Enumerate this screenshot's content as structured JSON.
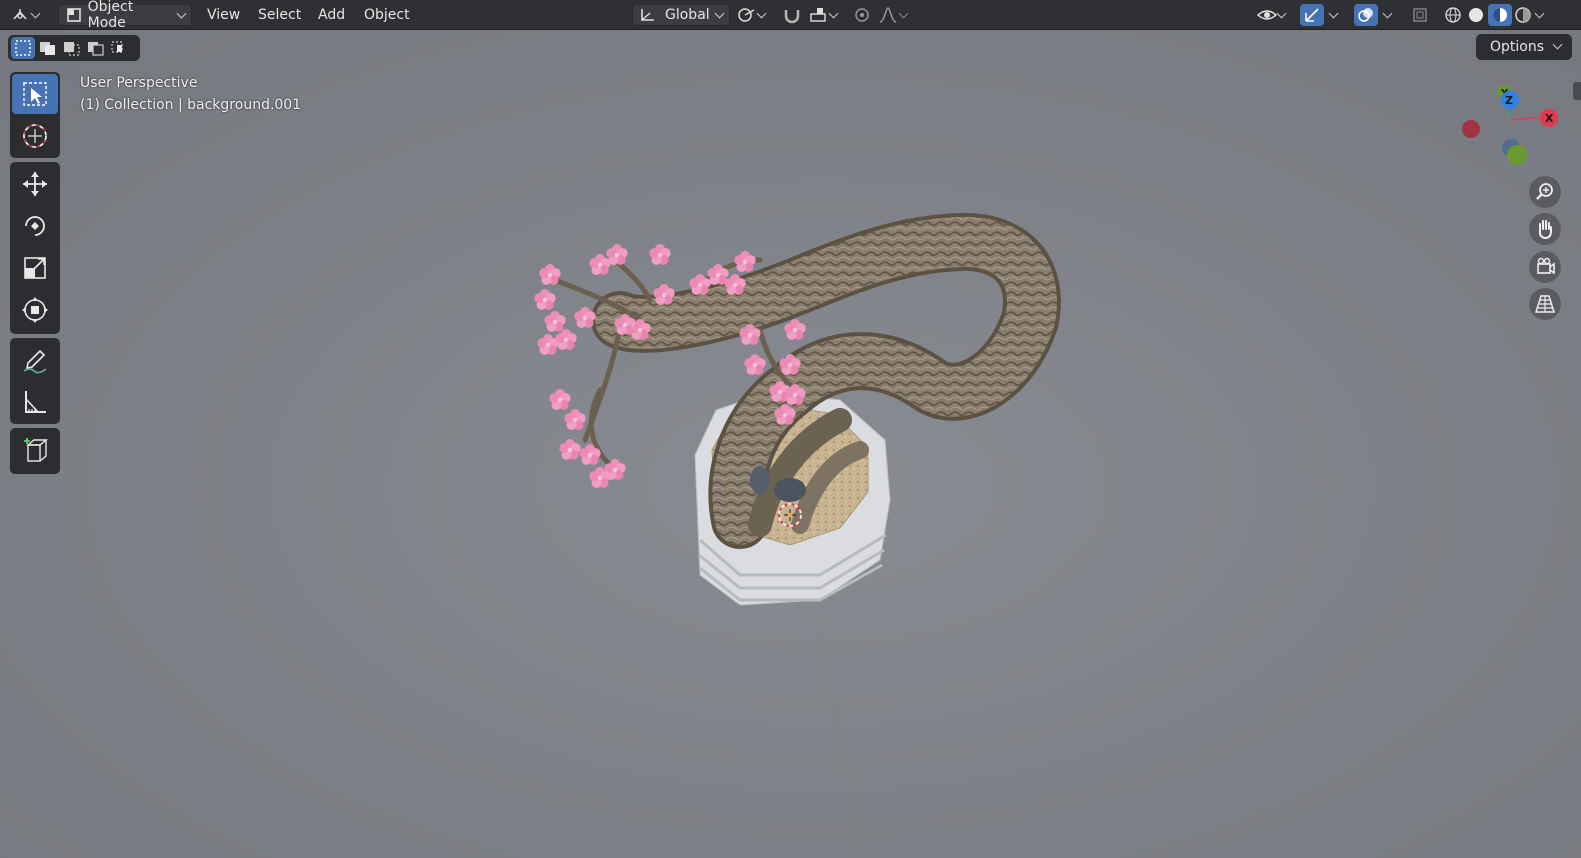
{
  "header": {
    "mode_label": "Object Mode",
    "menus": [
      "View",
      "Select",
      "Add",
      "Object"
    ],
    "orientation_label": "Global"
  },
  "viewport": {
    "perspective_label": "User Perspective",
    "collection_label": "(1) Collection | background.001",
    "options_label": "Options"
  },
  "gizmo": {
    "z_label": "Z",
    "x_label": "X",
    "y_label": "Y",
    "colors": {
      "x": "#e03a4e",
      "y": "#6a9a2e",
      "z": "#2f82e3"
    }
  },
  "colors": {
    "header_bg": "#2f3033",
    "active_tool": "#4772b3",
    "viewport_bg": "#7d8087",
    "blossom": "#ee8fb8"
  }
}
